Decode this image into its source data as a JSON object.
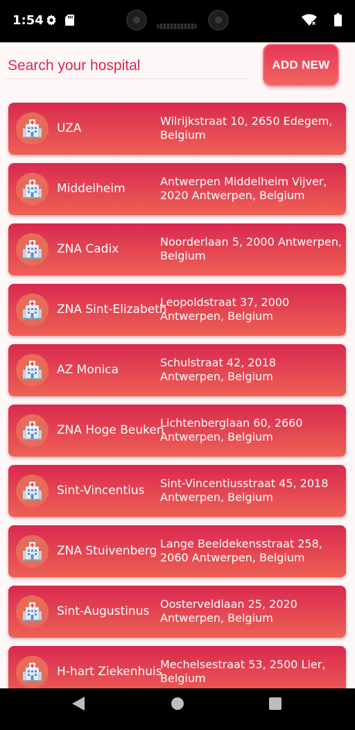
{
  "status_bar": {
    "time": "1:54",
    "icons": [
      "gear-icon",
      "sd-card-icon",
      "wifi-icon",
      "battery-icon"
    ]
  },
  "header": {
    "search_placeholder": "Search your hospital",
    "add_button_label": "ADD NEW"
  },
  "colors": {
    "accent": "#d8284d",
    "card_gradient_top": "#d92950",
    "card_gradient_bottom": "#ee6154",
    "background": "#fef7f7"
  },
  "hospitals": [
    {
      "name": "UZA",
      "address": "Wilrijkstraat 10, 2650 Edegem, Belgium",
      "icon": "hospital-icon"
    },
    {
      "name": "Middelheim",
      "address": "Antwerpen Middelheim Vijver, 2020 Antwerpen, Belgium",
      "icon": "hospital-icon"
    },
    {
      "name": "ZNA Cadix",
      "address": "Noorderlaan 5, 2000 Antwerpen, Belgium",
      "icon": "hospital-icon"
    },
    {
      "name": "ZNA Sint-Elizabeth",
      "address": "Leopoldstraat 37, 2000 Antwerpen, Belgium",
      "icon": "hospital-icon"
    },
    {
      "name": "AZ Monica",
      "address": "Schulstraat 42, 2018 Antwerpen, Belgium",
      "icon": "hospital-icon"
    },
    {
      "name": "ZNA Hoge Beuken",
      "address": "Lichtenberglaan 60, 2660 Antwerpen, Belgium",
      "icon": "hospital-icon"
    },
    {
      "name": "Sint-Vincentius",
      "address": "Sint-Vincentiusstraat 45, 2018 Antwerpen, Belgium",
      "icon": "hospital-icon"
    },
    {
      "name": "ZNA Stuivenberg",
      "address": "Lange Beeldekensstraat 258, 2060 Antwerpen, Belgium",
      "icon": "hospital-icon"
    },
    {
      "name": "Sint-Augustinus",
      "address": "Oosterveldlaan 25, 2020 Antwerpen, Belgium",
      "icon": "hospital-icon"
    },
    {
      "name": "H-hart Ziekenhuis",
      "address": "Mechelsestraat 53, 2500 Lier, Belgium",
      "icon": "hospital-icon"
    }
  ],
  "nav_bar": {
    "icons": [
      "back-icon",
      "home-icon",
      "recents-icon"
    ]
  }
}
